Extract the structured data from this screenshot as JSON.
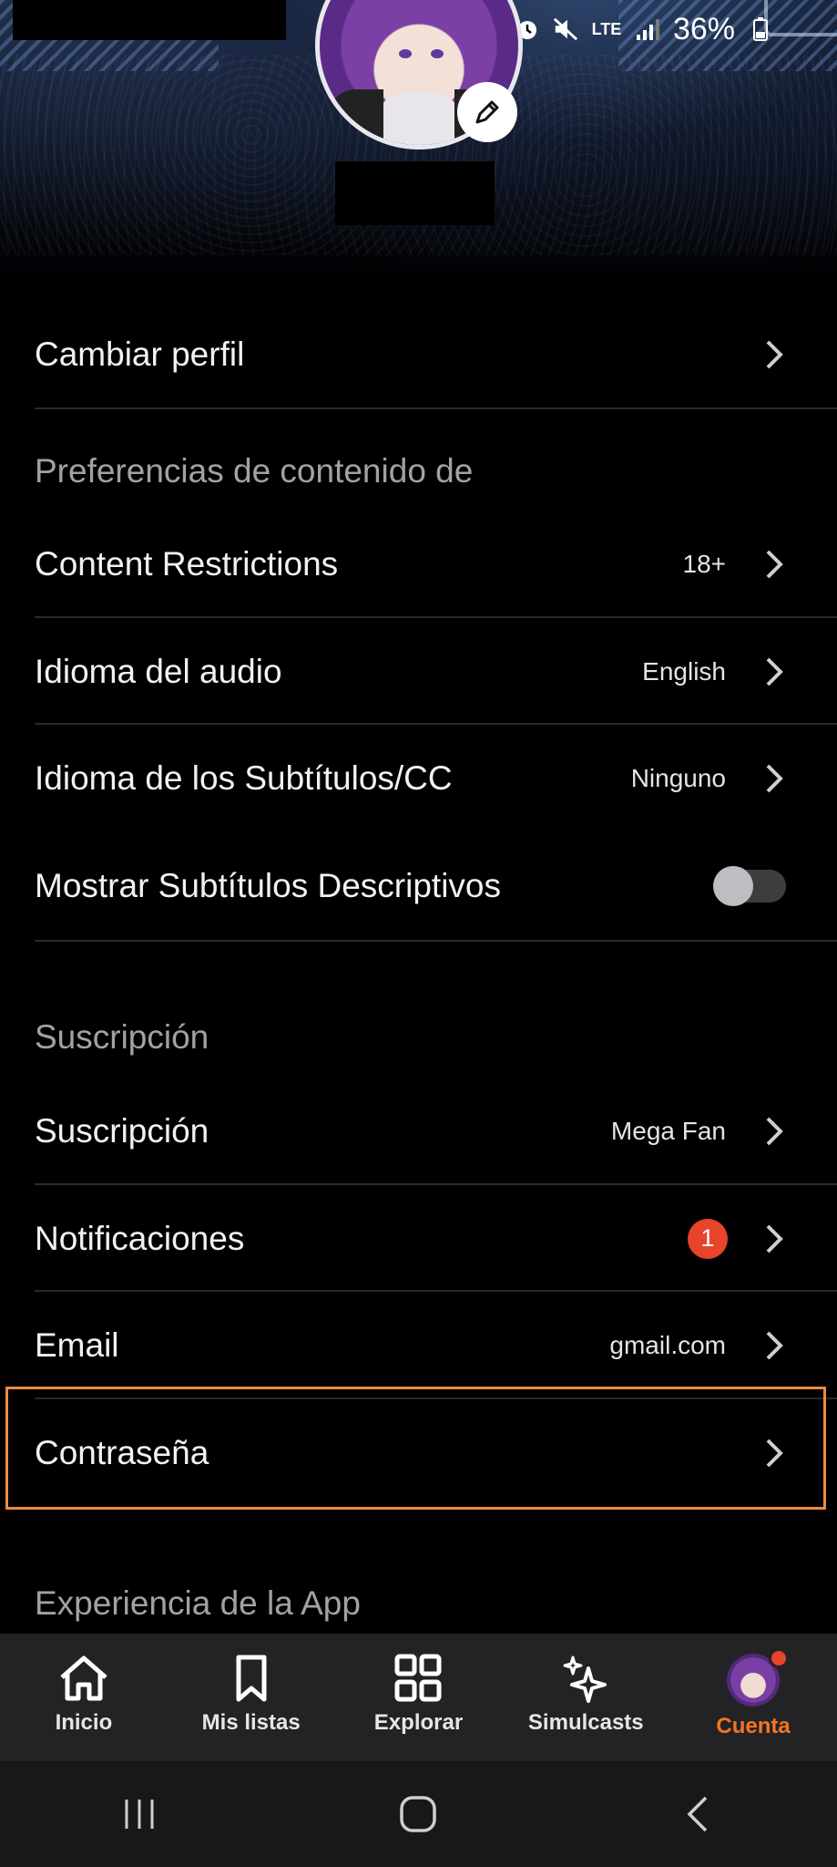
{
  "status_bar": {
    "battery_percent": "36%",
    "network": "LTE"
  },
  "menu": {
    "cambiar_perfil": "Cambiar perfil",
    "section_content_prefs": "Preferencias de contenido de",
    "content_restrictions": {
      "label": "Content Restrictions",
      "value": "18+"
    },
    "audio_language": {
      "label": "Idioma del audio",
      "value": "English"
    },
    "subtitle_language": {
      "label": "Idioma de los Subtítulos/CC",
      "value": "Ninguno"
    },
    "descriptive_subtitles": {
      "label": "Mostrar Subtítulos Descriptivos",
      "enabled": false
    },
    "section_subscription": "Suscripción",
    "subscription": {
      "label": "Suscripción",
      "value": "Mega Fan"
    },
    "notifications": {
      "label": "Notificaciones",
      "badge": "1"
    },
    "email": {
      "label": "Email",
      "value": "gmail.com"
    },
    "password": {
      "label": "Contraseña"
    },
    "section_app_experience": "Experiencia de la App"
  },
  "bottom_nav": [
    {
      "label": "Inicio",
      "icon": "home-icon"
    },
    {
      "label": "Mis listas",
      "icon": "bookmark-icon"
    },
    {
      "label": "Explorar",
      "icon": "grid-icon"
    },
    {
      "label": "Simulcasts",
      "icon": "sparkle-icon"
    },
    {
      "label": "Cuenta",
      "icon": "avatar",
      "active": true
    }
  ],
  "colors": {
    "accent": "#f47521",
    "badge": "#e8432b",
    "highlight": "#f08a3c"
  }
}
